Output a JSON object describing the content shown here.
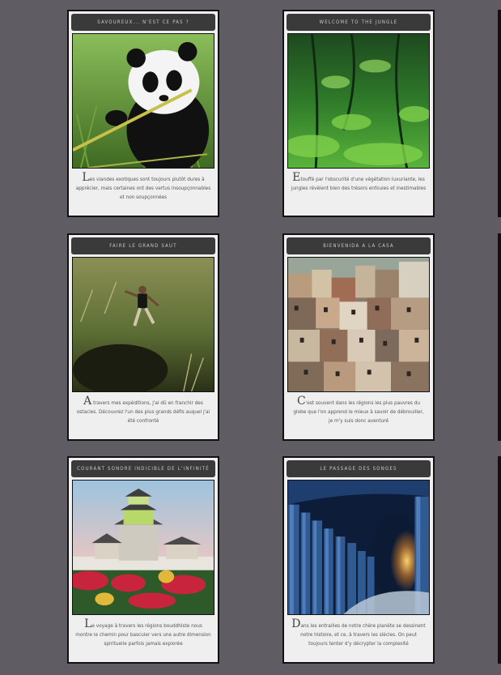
{
  "cards": [
    {
      "title": "Savoureux... n'est ce pas ?",
      "drop": "L",
      "text": "es viandes exotiques sont toujours plutôt dures à apprécier, mais certaines ont des vertus insoupçonnables et non soupçonnées",
      "image": "panda-photo"
    },
    {
      "title": "Welcome to the jungle",
      "drop": "E",
      "text": "touffé par l'obscurité d'une végétation luxuriante, les jungles révèlent bien des trésors enfouies et inestimables",
      "image": "jungle-photo"
    },
    {
      "title": "Faire le grand saut",
      "drop": "A",
      "text": " travers mes expéditions, j'ai dû en franchir des ostacles. Découvrez l'un des plus grands défis auquel j'ai été confronté",
      "image": "jump-photo"
    },
    {
      "title": "Bienvenida a la casa",
      "drop": "C",
      "text": "'est souvent dans les régions les plus pauvres du globe que l'on apprend le mieux à savoir de débrouiller, je m'y suis donc aventuré",
      "image": "favela-photo"
    },
    {
      "title": "Courant sonore indicible de l'infinité",
      "drop": "L",
      "text": "e voyage à travers les régions bouddhiste nous montre le chemin pour basculer vers une autre dimension spirituelle parfois jamais explorée",
      "image": "castle-photo"
    },
    {
      "title": "Le passage des songes",
      "drop": "D",
      "text": "ans les entrailles de notre chère planète se dessinent notre histoire, et ce, à travers les siècles. On peut toujours tenter d'y décrypter la complexité",
      "image": "cave-photo"
    }
  ]
}
